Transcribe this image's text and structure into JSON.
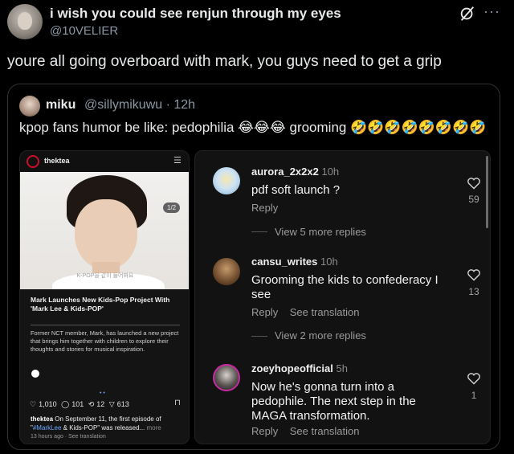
{
  "tweet": {
    "author_name": "i wish you could see renjun through my eyes",
    "author_handle": "@10VELIER",
    "text": "youre all going overboard with mark, you guys need to get a grip",
    "icons": [
      "grok-icon",
      "more-icon"
    ]
  },
  "quote": {
    "name": "miku",
    "handle_time": "@sillymikuwu · 12h",
    "text": "kpop fans humor be like: pedophilia 😂😂😂 grooming 🤣🤣🤣🤣🤣🤣🤣🤣"
  },
  "post": {
    "brand": "thektea",
    "page_badge": "1/2",
    "photo_caption": "K-POP을 같이 들어봐요",
    "headline": "Mark Launches New Kids-Pop Project With 'Mark Lee & Kids-POP'",
    "body": "Former NCT member, Mark, has launched a new project that brings him together with children to explore their thoughts and stories for musical inspiration.",
    "likes": "1,010",
    "comments": "101",
    "reposts": "12",
    "shares": "613",
    "caption_user": "thektea",
    "caption_text_1": "On September 11, the first episode of \"",
    "caption_tag": "#MarkLee",
    "caption_text_2": " & Kids-POP\" was released...",
    "caption_more": "more",
    "time": "13 hours ago",
    "see_translation": "See translation"
  },
  "comments": [
    {
      "user": "aurora_2x2x2",
      "age": "10h",
      "text": "pdf soft launch ?",
      "reply": "Reply",
      "likes": "59",
      "view_more": "View 5 more replies"
    },
    {
      "user": "cansu_writes",
      "age": "10h",
      "text": "Grooming the kids to confederacy I see",
      "reply": "Reply",
      "see_translation": "See translation",
      "likes": "13",
      "view_more": "View 2 more replies"
    },
    {
      "user": "zoeyhopeofficial",
      "age": "5h",
      "text": "Now he's gonna turn into a pedophile. The next step in the MAGA transformation.",
      "reply": "Reply",
      "see_translation": "See translation",
      "likes": "1"
    }
  ],
  "colors": {
    "background": "#000000",
    "text": "#e7e9ea",
    "secondary": "#8b98a5",
    "border": "#2f3336",
    "hashtag": "#6ea8fe"
  }
}
